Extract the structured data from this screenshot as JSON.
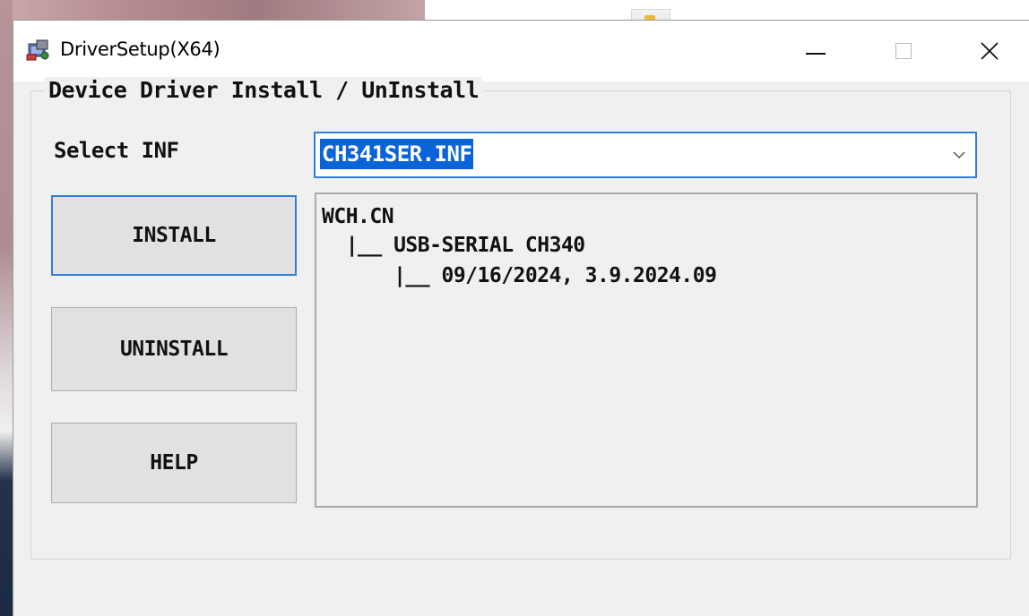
{
  "window": {
    "title": "DriverSetup(X64)"
  },
  "icons": {
    "app": "driver-setup-icon",
    "minimize": "minimize-icon",
    "maximize": "maximize-icon",
    "close": "close-icon",
    "dropdown": "chevron-down-icon"
  },
  "group": {
    "label": "Device Driver Install / UnInstall"
  },
  "inf_selector": {
    "label": "Select INF",
    "value": "CH341SER.INF"
  },
  "buttons": {
    "install": "INSTALL",
    "uninstall": "UNINSTALL",
    "help": "HELP"
  },
  "driver_info": {
    "lines": [
      "WCH.CN",
      "  |__ USB-SERIAL CH340",
      "      |__ 09/16/2024, 3.9.2024.09"
    ]
  },
  "colors": {
    "accent": "#2f7fd8",
    "selection": "#0a64d8",
    "window_bg": "#f0f0f0",
    "button_bg": "#e1e1e1"
  }
}
